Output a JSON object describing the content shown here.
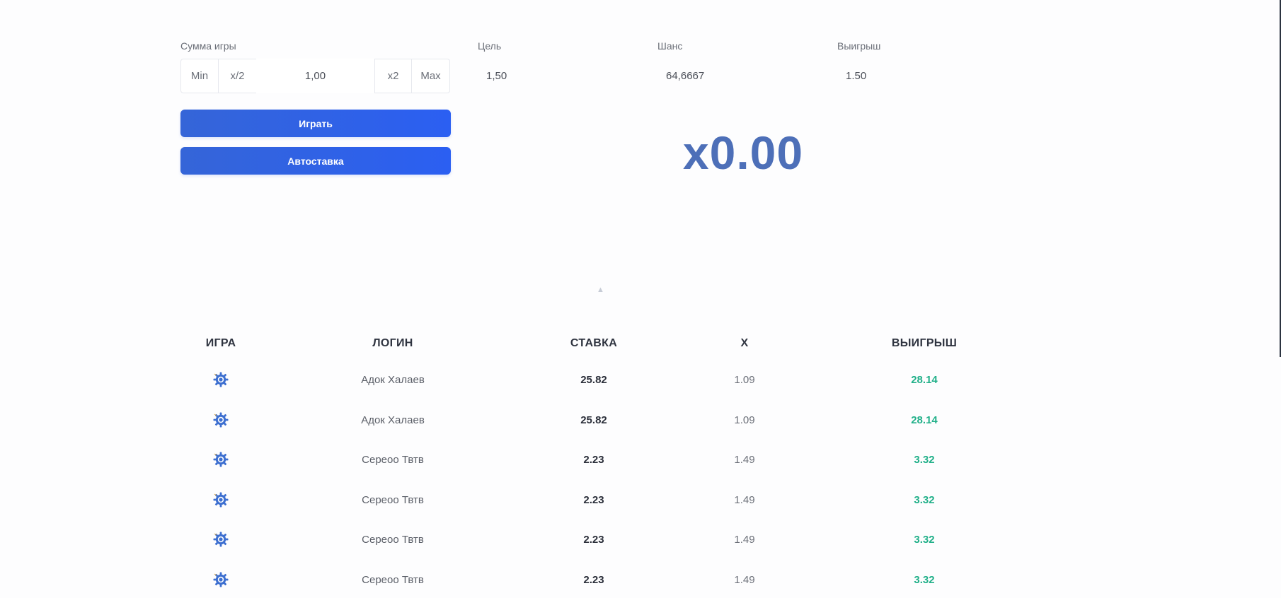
{
  "bet": {
    "label": "Сумма игры",
    "min_label": "Min",
    "half_label": "x/2",
    "value": "1,00",
    "double_label": "x2",
    "max_label": "Max"
  },
  "target": {
    "label": "Цель",
    "value": "1,50"
  },
  "chance": {
    "label": "Шанс",
    "value": "64,6667"
  },
  "payout": {
    "label": "Выигрыш",
    "value": "1.50"
  },
  "buttons": {
    "play": "Играть",
    "autobet": "Автоставка"
  },
  "multiplier": "x0.00",
  "toggle_arrow": "▲",
  "table": {
    "headers": [
      "ИГРА",
      "ЛОГИН",
      "СТАВКА",
      "X",
      "ВЫИГРЫШ"
    ],
    "rows": [
      {
        "login": "Адок Халаев",
        "bet": "25.82",
        "x": "1.09",
        "win": "28.14"
      },
      {
        "login": "Адок Халаев",
        "bet": "25.82",
        "x": "1.09",
        "win": "28.14"
      },
      {
        "login": "Сереоо Твтв",
        "bet": "2.23",
        "x": "1.49",
        "win": "3.32"
      },
      {
        "login": "Сереоо Твтв",
        "bet": "2.23",
        "x": "1.49",
        "win": "3.32"
      },
      {
        "login": "Сереоо Твтв",
        "bet": "2.23",
        "x": "1.49",
        "win": "3.32"
      },
      {
        "login": "Сереоо Твтв",
        "bet": "2.23",
        "x": "1.49",
        "win": "3.32"
      }
    ],
    "game_icon": "gear-icon"
  },
  "colors": {
    "accent": "#2b5ff2",
    "multiplier": "#4d6fb8",
    "win": "#21b089"
  }
}
